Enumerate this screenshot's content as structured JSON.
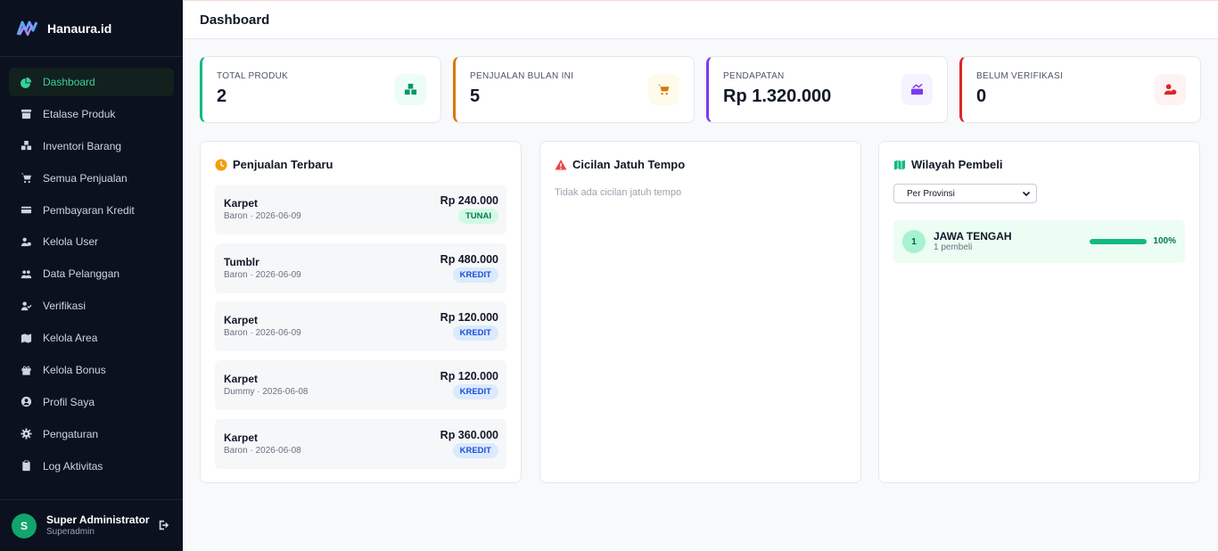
{
  "app": {
    "brand": "Hanaura.id"
  },
  "sidebar": {
    "items": [
      {
        "label": "Dashboard",
        "icon": "chart-pie-icon",
        "active": true
      },
      {
        "label": "Etalase Produk",
        "icon": "archive-icon"
      },
      {
        "label": "Inventori Barang",
        "icon": "boxes-icon"
      },
      {
        "label": "Semua Penjualan",
        "icon": "cart-icon"
      },
      {
        "label": "Pembayaran Kredit",
        "icon": "credit-card-icon"
      },
      {
        "label": "Kelola User",
        "icon": "users-cog-icon"
      },
      {
        "label": "Data Pelanggan",
        "icon": "users-icon"
      },
      {
        "label": "Verifikasi",
        "icon": "user-check-icon"
      },
      {
        "label": "Kelola Area",
        "icon": "map-icon"
      },
      {
        "label": "Kelola Bonus",
        "icon": "gift-icon"
      },
      {
        "label": "Profil Saya",
        "icon": "user-circle-icon"
      },
      {
        "label": "Pengaturan",
        "icon": "gear-icon"
      },
      {
        "label": "Log Aktivitas",
        "icon": "clipboard-icon"
      }
    ]
  },
  "user": {
    "initial": "S",
    "name": "Super Administrator",
    "role": "Superadmin"
  },
  "header": {
    "title": "Dashboard"
  },
  "stats": [
    {
      "label": "TOTAL PRODUK",
      "value": "2",
      "accent": "#10b981",
      "icon": "boxes-icon",
      "icon_bg": "#ecfdf5",
      "icon_color": "#059669"
    },
    {
      "label": "PENJUALAN BULAN INI",
      "value": "5",
      "accent": "#d97706",
      "icon": "cart-icon",
      "icon_bg": "#fffbeb",
      "icon_color": "#d97706"
    },
    {
      "label": "PENDAPATAN",
      "value": "Rp 1.320.000",
      "accent": "#7c3aed",
      "icon": "money-chart-icon",
      "icon_bg": "#f5f3ff",
      "icon_color": "#7c3aed"
    },
    {
      "label": "BELUM VERIFIKASI",
      "value": "0",
      "accent": "#dc2626",
      "icon": "user-clock-icon",
      "icon_bg": "#fef2f2",
      "icon_color": "#dc2626"
    }
  ],
  "recent_sales": {
    "title": "Penjualan Terbaru",
    "icon": "clock-icon",
    "items": [
      {
        "product": "Karpet",
        "meta": "Baron · 2026-06-09",
        "amount": "Rp 240.000",
        "type": "TUNAI"
      },
      {
        "product": "Tumblr",
        "meta": "Baron · 2026-06-09",
        "amount": "Rp 480.000",
        "type": "KREDIT"
      },
      {
        "product": "Karpet",
        "meta": "Baron · 2026-06-09",
        "amount": "Rp 120.000",
        "type": "KREDIT"
      },
      {
        "product": "Karpet",
        "meta": "Dummy · 2026-06-08",
        "amount": "Rp 120.000",
        "type": "KREDIT"
      },
      {
        "product": "Karpet",
        "meta": "Baron · 2026-06-08",
        "amount": "Rp 360.000",
        "type": "KREDIT"
      }
    ]
  },
  "installments": {
    "title": "Cicilan Jatuh Tempo",
    "icon": "warning-icon",
    "empty_text": "Tidak ada cicilan jatuh tempo"
  },
  "regions": {
    "title": "Wilayah Pembeli",
    "icon": "map-icon",
    "select_value": "Per Provinsi",
    "items": [
      {
        "rank": "1",
        "name": "JAWA TENGAH",
        "sub": "1 pembeli",
        "percent_label": "100%",
        "percent": 100
      }
    ]
  }
}
